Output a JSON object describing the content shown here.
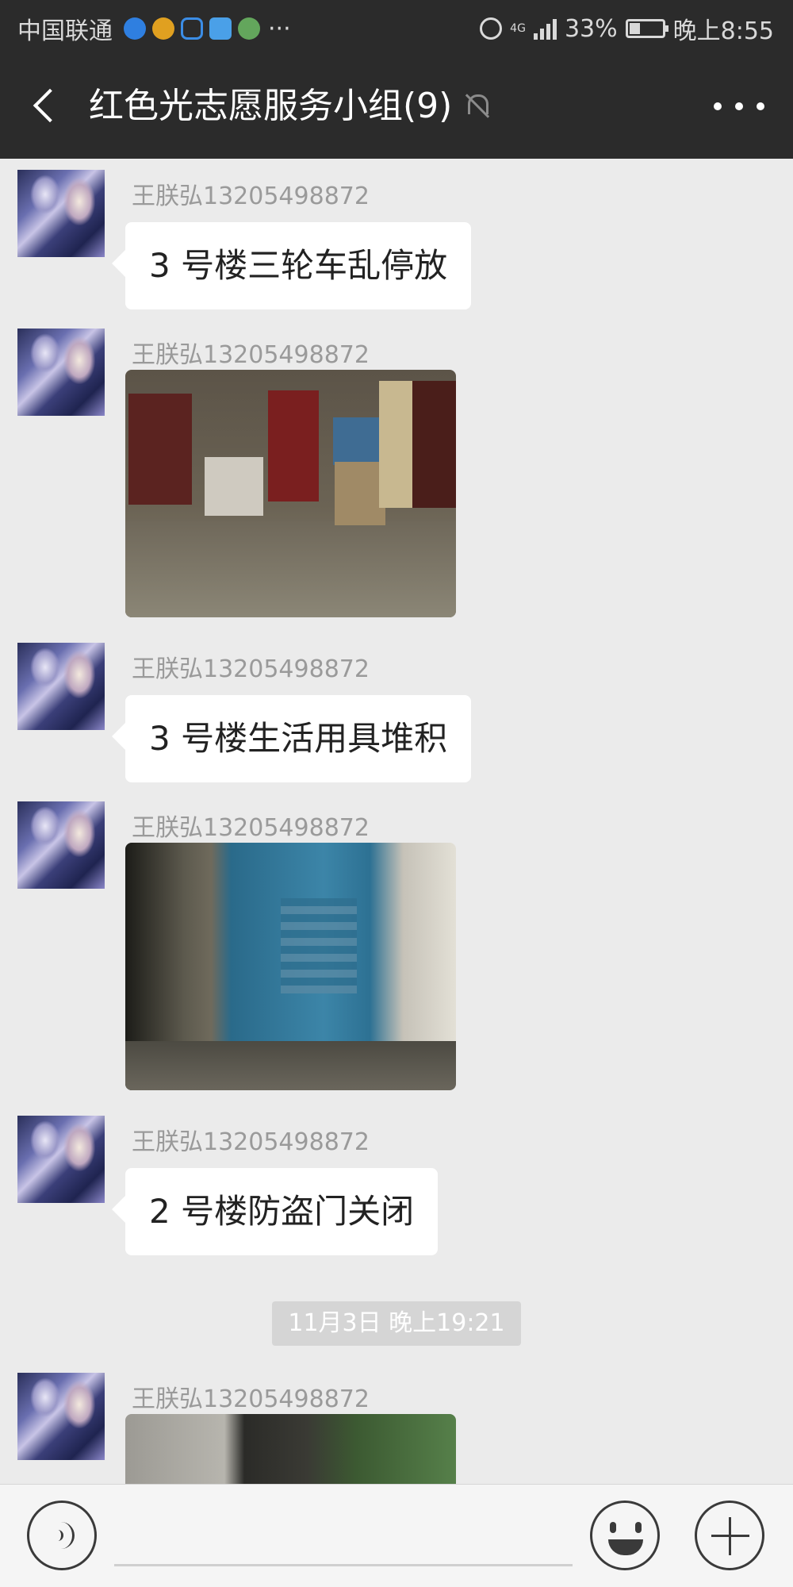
{
  "status_bar": {
    "carrier": "中国联通",
    "overflow": "···",
    "network": "4G",
    "battery": "33%",
    "time": "晚上8:55",
    "battery_level": 0.33
  },
  "header": {
    "title": "红色光志愿服务小组(9)",
    "icons": [
      "back-icon",
      "mute-icon",
      "more-icon"
    ]
  },
  "messages": [
    {
      "sender": "王朕弘13205498872",
      "type": "text",
      "text": "3 号楼三轮车乱停放"
    },
    {
      "sender": "王朕弘13205498872",
      "type": "image"
    },
    {
      "sender": "王朕弘13205498872",
      "type": "text",
      "text": "3 号楼生活用具堆积"
    },
    {
      "sender": "王朕弘13205498872",
      "type": "image"
    },
    {
      "sender": "王朕弘13205498872",
      "type": "text",
      "text": "2 号楼防盗门关闭"
    },
    {
      "sender": "王朕弘13205498872",
      "type": "image"
    }
  ],
  "time_divider": "11月3日 晚上19:21",
  "input_bar": {
    "icons": [
      "voice-icon",
      "emoji-icon",
      "plus-icon"
    ]
  }
}
